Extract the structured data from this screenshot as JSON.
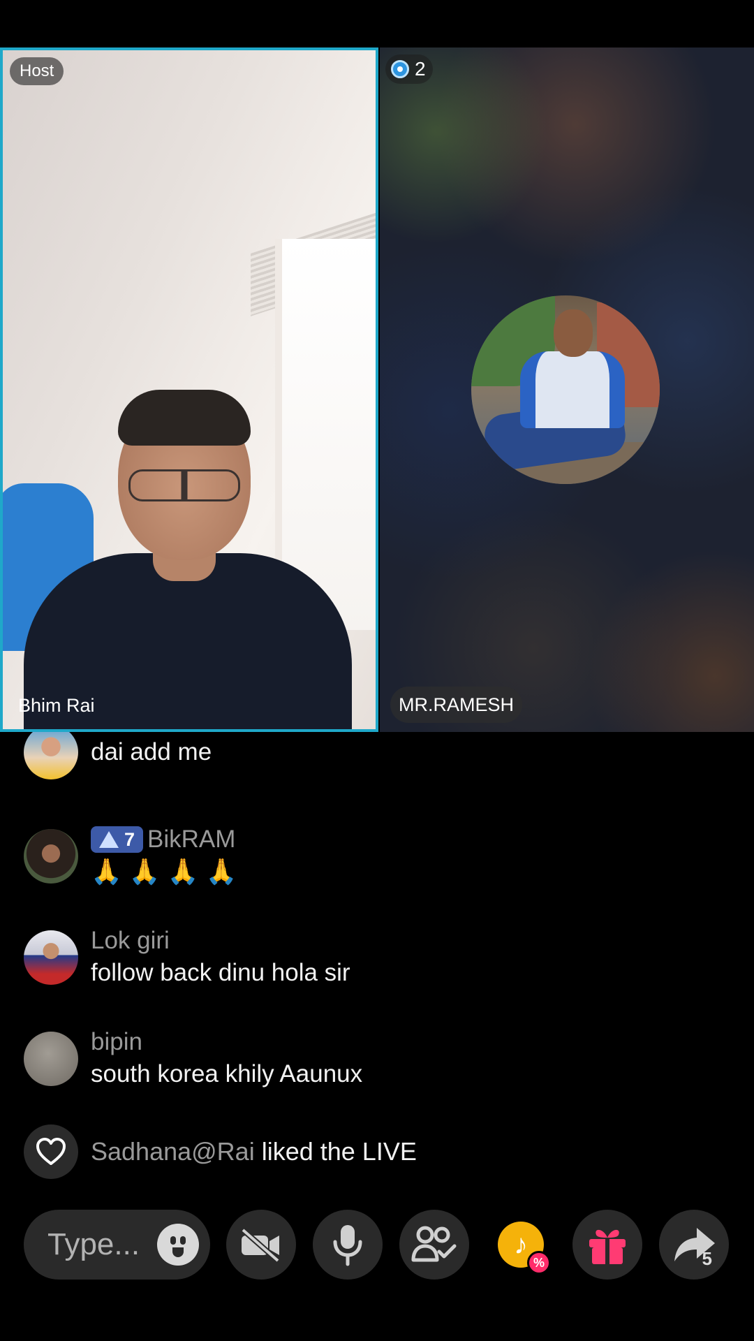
{
  "host_tile": {
    "role_badge": "Host",
    "name": "Bhim Rai"
  },
  "guest_tile": {
    "viewer_count": "2",
    "name": "MR.RAMESH"
  },
  "chat": {
    "messages": [
      {
        "user": "",
        "text": "dai add me"
      },
      {
        "user": "BikRAM",
        "badge_level": "7",
        "text": "🙏 🙏 🙏 🙏"
      },
      {
        "user": "Lok giri",
        "text": "follow back dinu hola sir"
      },
      {
        "user": "bipin",
        "text": "south korea  khily Aaunux"
      }
    ],
    "liked": {
      "user": "Sadhana@Rai",
      "text": "liked the LIVE"
    }
  },
  "bottom_bar": {
    "comment_placeholder": "Type...",
    "share_count": "5",
    "promo_tag": "%"
  },
  "colors": {
    "host_border": "#1fa8c9",
    "rank_badge": "#3d5aa8",
    "gift": "#ff3b73",
    "promo": "#f5b20a"
  }
}
